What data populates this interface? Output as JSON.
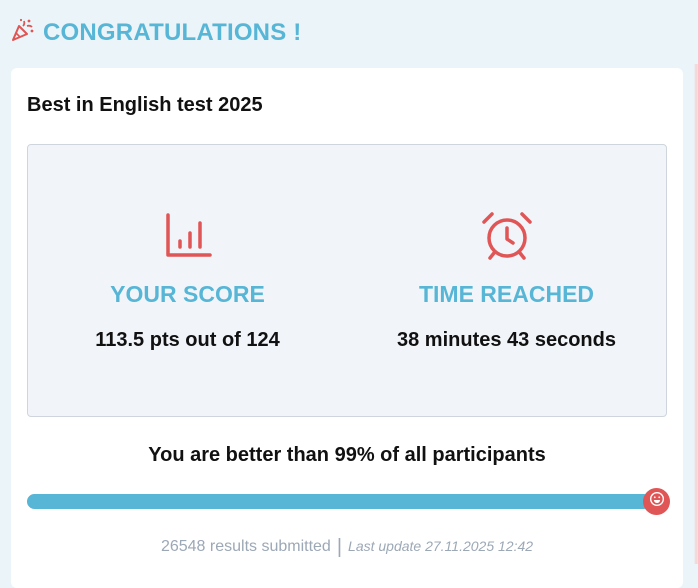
{
  "header": {
    "title": "CONGRATULATIONS !",
    "icon": "party-popper-icon",
    "accent": "#57b5d6"
  },
  "card": {
    "title": "Best in English test 2025",
    "score": {
      "icon": "bar-chart-icon",
      "label": "YOUR SCORE",
      "value": "113.5 pts out of 124"
    },
    "time": {
      "icon": "alarm-clock-icon",
      "label": "TIME REACHED",
      "value": "38 minutes 43 seconds"
    },
    "better_text": "You are better than 99% of all participants",
    "progress": {
      "percent": 99,
      "knob_icon": "smiley-icon",
      "fill_color": "#57b5d6",
      "knob_color": "#e05555"
    },
    "footer": {
      "submitted": "26548 results submitted",
      "separator": "|",
      "last_update": "Last update 27.11.2025 12:42"
    }
  }
}
